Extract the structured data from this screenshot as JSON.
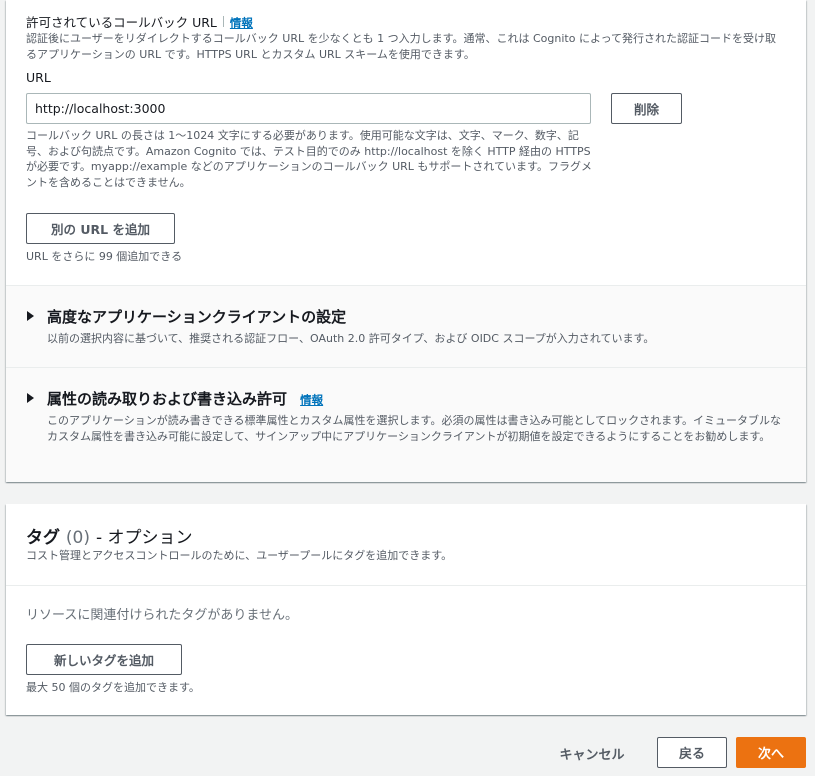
{
  "callback": {
    "title": "許可されているコールバック URL",
    "info_label": "情報",
    "description": "認証後にユーザーをリダイレクトするコールバック URL を少なくとも 1 つ入力します。通常、これは Cognito によって発行された認証コードを受け取るアプリケーションの URL です。HTTPS URL とカスタム URL スキームを使用できます。",
    "url_label": "URL",
    "url_value": "http://localhost:3000",
    "delete_label": "削除",
    "constraint": "コールバック URL の長さは 1～1024 文字にする必要があります。使用可能な文字は、文字、マーク、数字、記号、および句読点です。Amazon Cognito では、テスト目的でのみ http://localhost を除く HTTP 経由の HTTPS が必要です。myapp://example などのアプリケーションのコールバック URL もサポートされています。フラグメントを含めることはできません。",
    "add_url_label": "別の URL を追加",
    "remaining": "URL をさらに 99 個追加できる"
  },
  "advanced": {
    "title": "高度なアプリケーションクライアントの設定",
    "description": "以前の選択内容に基づいて、推奨される認証フロー、OAuth 2.0 許可タイプ、および OIDC スコープが入力されています。"
  },
  "attributes": {
    "title": "属性の読み取りおよび書き込み許可",
    "info_label": "情報",
    "description": "このアプリケーションが読み書きできる標準属性とカスタム属性を選択します。必須の属性は書き込み可能としてロックされます。イミュータブルなカスタム属性を書き込み可能に設定して、サインアップ中にアプリケーションクライアントが初期値を設定できるようにすることをお勧めします。"
  },
  "tags": {
    "title": "タグ",
    "count": "(0)",
    "optional": "- オプション",
    "description": "コスト管理とアクセスコントロールのために、ユーザープールにタグを追加できます。",
    "empty": "リソースに関連付けられたタグがありません。",
    "add_label": "新しいタグを追加",
    "limit": "最大 50 個のタグを追加できます。"
  },
  "footer": {
    "cancel": "キャンセル",
    "back": "戻る",
    "next": "次へ"
  },
  "colors": {
    "primary": "#ec7211",
    "link": "#0073bb",
    "background": "#f2f3f3"
  }
}
